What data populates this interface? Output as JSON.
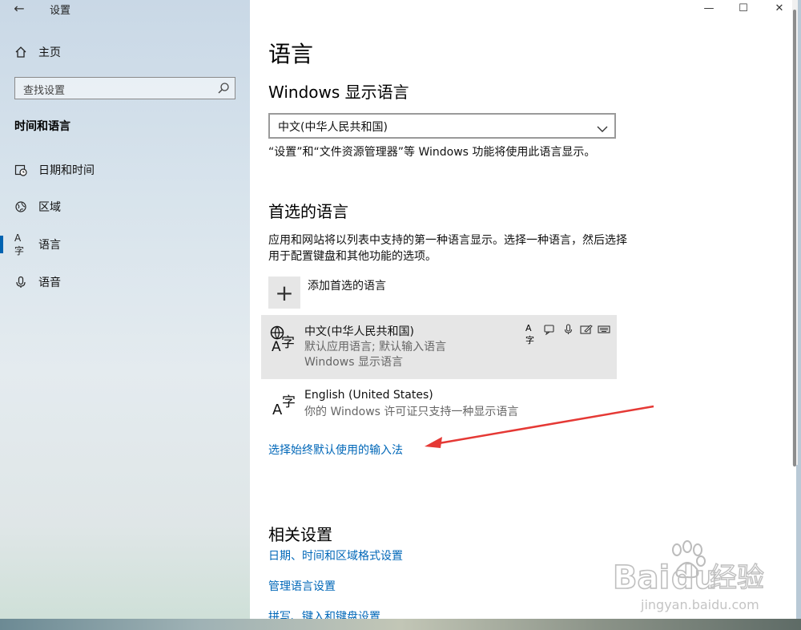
{
  "window": {
    "title": "设置",
    "controls": {
      "minimize": "—",
      "maximize": "☐",
      "close": "✕"
    }
  },
  "sidebar": {
    "home_label": "主页",
    "search_placeholder": "查找设置",
    "section_title": "时间和语言",
    "items": [
      {
        "label": "日期和时间",
        "icon": "clock-icon"
      },
      {
        "label": "区域",
        "icon": "globe-icon"
      },
      {
        "label": "语言",
        "icon": "language-icon",
        "active": true
      },
      {
        "label": "语音",
        "icon": "microphone-icon"
      }
    ]
  },
  "main": {
    "page_title": "语言",
    "display_language": {
      "heading": "Windows 显示语言",
      "selected": "中文(中华人民共和国)",
      "note": "“设置”和“文件资源管理器”等 Windows 功能将使用此语言显示。"
    },
    "preferred": {
      "heading": "首选的语言",
      "description_line1": "应用和网站将以列表中支持的第一种语言显示。选择一种语言，然后选择",
      "description_line2": "用于配置键盘和其他功能的选项。",
      "add_label": "添加首选的语言",
      "languages": [
        {
          "name": "中文(中华人民共和国)",
          "sub1": "默认应用语言; 默认输入语言",
          "sub2": "Windows 显示语言"
        },
        {
          "name": "English (United States)",
          "sub1": "你的 Windows 许可证只支持一种显示语言"
        }
      ]
    },
    "input_method_link": "选择始终默认使用的输入法",
    "related": {
      "heading": "相关设置",
      "links": [
        "日期、时间和区域格式设置",
        "管理语言设置",
        "拼写、键入和键盘设置"
      ]
    }
  },
  "watermark": {
    "brand": "Bai",
    "brand2": "du",
    "cn": "经验",
    "url": "jingyan.baidu.com"
  },
  "colors": {
    "accent": "#0067b8",
    "arrow": "#e53935"
  }
}
